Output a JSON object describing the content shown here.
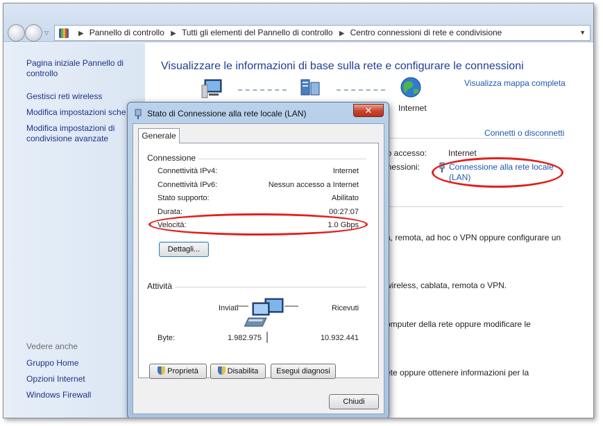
{
  "address_bar": {
    "breadcrumbs": [
      "Pannello di controllo",
      "Tutti gli elementi del Pannello di controllo",
      "Centro connessioni di rete e condivisione"
    ]
  },
  "sidebar": {
    "home_link": "Pagina iniziale Pannello di controllo",
    "links": [
      "Gestisci reti wireless",
      "Modifica impostazioni sche",
      "Modifica impostazioni di condivisione avanzate"
    ],
    "see_also_heading": "Vedere anche",
    "see_also": [
      "Gruppo Home",
      "Opzioni Internet",
      "Windows Firewall"
    ]
  },
  "main": {
    "title": "Visualizzare le informazioni di base sulla rete e configurare le connessioni",
    "full_map_link": "Visualizza mappa completa",
    "internet_label": "Internet",
    "connect_link": "Connetti o disconnetti",
    "access_type_label": "po accesso:",
    "access_type_value": "Internet",
    "connections_label": "nnessioni:",
    "connection_link": "Connessione alla rete locale (LAN)",
    "text_1": "a, remota, ad hoc o VPN oppure configurare un",
    "text_2": "wireless, cablata, remota o VPN.",
    "text_3": "omputer della rete oppure modificare le",
    "text_4": "ete oppure ottenere informazioni per la"
  },
  "dialog": {
    "title": "Stato di Connessione alla rete locale (LAN)",
    "close_symbol": "✕",
    "tab": "Generale",
    "connection_group": "Connessione",
    "rows": [
      {
        "label": "Connettività IPv4:",
        "value": "Internet"
      },
      {
        "label": "Connettività IPv6:",
        "value": "Nessun accesso a Internet"
      },
      {
        "label": "Stato supporto:",
        "value": "Abilitato"
      },
      {
        "label": "Durata:",
        "value": "00:27:07"
      },
      {
        "label": "Velocità:",
        "value": "1.0 Gbps"
      }
    ],
    "details_button": "Dettagli...",
    "activity_group": "Attività",
    "sent_label": "Inviati",
    "received_label": "Ricevuti",
    "bytes_label": "Byte:",
    "bytes_sent": "1.982.975",
    "bytes_received": "10.932.441",
    "properties_button": "Proprietà",
    "disable_button": "Disabilita",
    "diagnose_button": "Esegui diagnosi",
    "close_button": "Chiudi"
  },
  "colors": {
    "link": "#1e58b0",
    "title": "#1e3e95",
    "highlight_ellipse": "#e0201c"
  }
}
